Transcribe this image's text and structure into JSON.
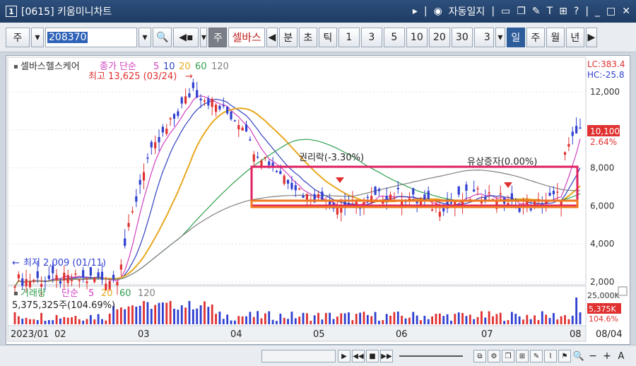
{
  "window": {
    "badge": "1",
    "title": "[0615] 키움미니차트",
    "autolog_label": "자동일지",
    "right_icons": [
      "play-triangle-icon",
      "pipe-icon",
      "record-icon",
      "window-icon",
      "copy-icon",
      "paint-icon",
      "text-icon",
      "grid-icon",
      "help-icon",
      "minimize-icon",
      "maximize-icon",
      "close-icon"
    ]
  },
  "toolbar": {
    "market": "주",
    "code": "208370",
    "sound_icon": "speaker-icon",
    "tag_label": "주",
    "stock_name": "셀바스",
    "period_buttons": [
      "분",
      "초",
      "틱"
    ],
    "interval_buttons": [
      "1",
      "3",
      "5",
      "10",
      "20",
      "30"
    ],
    "custom_interval": "3",
    "type_buttons": [
      "일",
      "주",
      "월",
      "년"
    ],
    "selected_type": "일"
  },
  "chart": {
    "stock_title": "셀바스헬스케어",
    "ma_label": "종가 단순",
    "ma_periods": [
      "5",
      "10",
      "20",
      "60",
      "120"
    ],
    "max_label": "최고 13,625 (03/24)",
    "min_label": "최저 2,009 (01/11)",
    "rights_label": "권리락(-3.30%)",
    "capital_label": "유상증자(0.00%)",
    "lc_label": "LC:383.4",
    "hc_label": "HC:-25.8",
    "price_current": "10,100",
    "change_pct": "2.64%",
    "price_ticks": [
      "12,000",
      "10,000",
      "8,000",
      "6,000",
      "4,000",
      "2,000"
    ],
    "volume_title": "거래량",
    "volume_ma_label": "단순",
    "volume_ma_periods": [
      "5",
      "20",
      "60",
      "120"
    ],
    "volume_info": "5,375,325주(104.69%)",
    "volume_tick": "25,000K",
    "volume_current": "5,375K",
    "volume_pct": "104.6%",
    "date_labels": [
      "2023/01",
      "02",
      "03",
      "04",
      "05",
      "06",
      "07",
      "08",
      "08/04"
    ],
    "colors": {
      "up": "#e03030",
      "down": "#2f3fd0",
      "ma5": "#d040c0",
      "ma10": "#3040c0",
      "ma20": "#e8a820",
      "ma60": "#30a050",
      "ma120": "#808080",
      "box_red": "#e02060",
      "box_orange": "#f07820"
    }
  },
  "chart_data": {
    "type": "candlestick",
    "x_dates": [
      "2023-01-11",
      "2023-03-24",
      "2023-08-04"
    ],
    "price_ylim": [
      2000,
      13600
    ],
    "price_ticks": [
      2000,
      4000,
      6000,
      8000,
      10000,
      12000
    ],
    "max_price": 13625,
    "min_price": 2009,
    "last_price": 10100,
    "last_change_pct": 2.64,
    "volume_tick": 25000,
    "last_volume_k": 5375,
    "last_volume_pct": 104.69
  }
}
